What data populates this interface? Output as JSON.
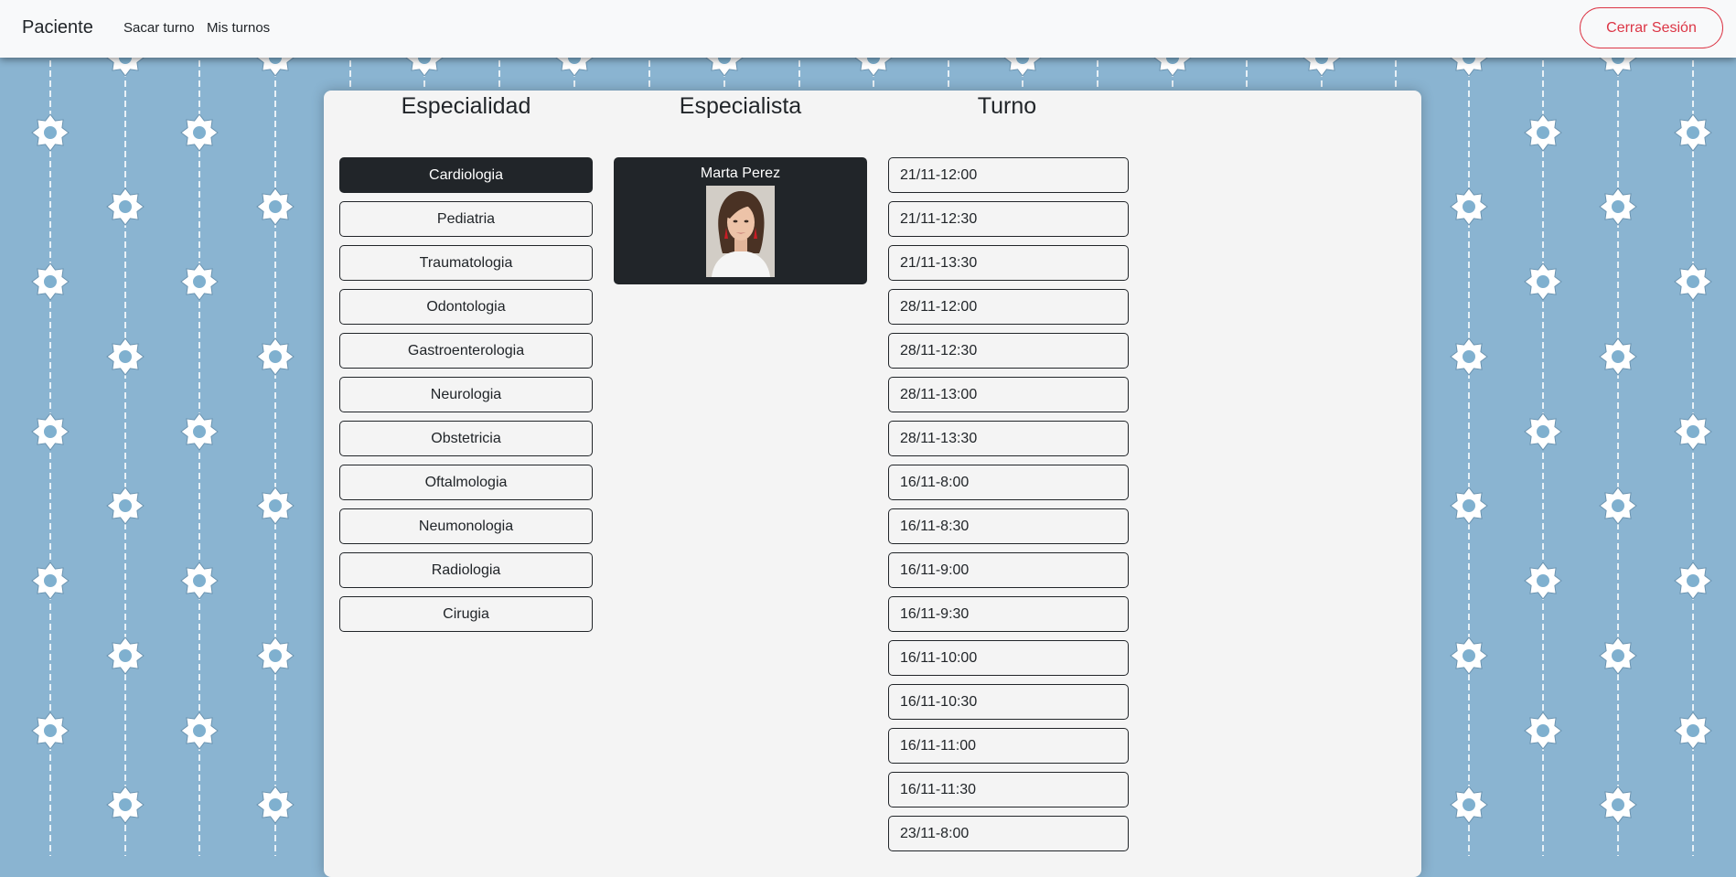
{
  "navbar": {
    "brand": "Paciente",
    "links": [
      "Sacar turno",
      "Mis turnos"
    ],
    "logout_label": "Cerrar Sesión"
  },
  "columns": {
    "especialidad": {
      "title": "Especialidad",
      "selected": "Cardiologia",
      "items": [
        "Cardiologia",
        "Pediatria",
        "Traumatologia",
        "Odontologia",
        "Gastroenterologia",
        "Neurologia",
        "Obstetricia",
        "Oftalmologia",
        "Neumonologia",
        "Radiologia",
        "Cirugia"
      ]
    },
    "especialista": {
      "title": "Especialista",
      "doctor": {
        "name": "Marta Perez",
        "photo_icon": "doctor-portrait"
      }
    },
    "turno": {
      "title": "Turno",
      "items": [
        "21/11-12:00",
        "21/11-12:30",
        "21/11-13:30",
        "28/11-12:00",
        "28/11-12:30",
        "28/11-13:00",
        "28/11-13:30",
        "16/11-8:00",
        "16/11-8:30",
        "16/11-9:00",
        "16/11-9:30",
        "16/11-10:00",
        "16/11-10:30",
        "16/11-11:00",
        "16/11-11:30",
        "23/11-8:00"
      ]
    }
  },
  "colors": {
    "background": "#8ab4d1",
    "navbar": "#f8f9fa",
    "panel": "#f4f4f4",
    "dark": "#212529",
    "danger": "#dc3545"
  }
}
